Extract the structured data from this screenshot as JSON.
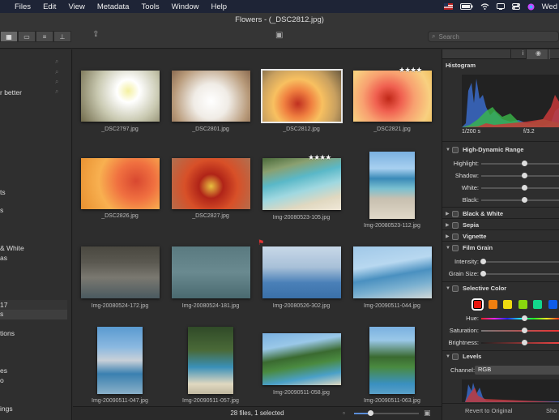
{
  "menubar": {
    "items": [
      "Files",
      "Edit",
      "View",
      "Metadata",
      "Tools",
      "Window",
      "Help"
    ],
    "clock": "Wed"
  },
  "window": {
    "title": "Flowers - (_DSC2812.jpg)",
    "search_placeholder": "Search"
  },
  "sidebar": {
    "fragments": [
      "r better",
      "ts",
      "s",
      "& White",
      "as",
      "17",
      "s",
      "tions",
      "es",
      "o",
      "ings"
    ]
  },
  "grid": {
    "items": [
      {
        "name": "_DSC2797.jpg",
        "stars": "",
        "flag": false,
        "selected": false
      },
      {
        "name": "_DSC2801.jpg",
        "stars": "",
        "flag": false,
        "selected": false
      },
      {
        "name": "_DSC2812.jpg",
        "stars": "",
        "flag": false,
        "selected": true
      },
      {
        "name": "_DSC2821.jpg",
        "stars": "★★★★",
        "flag": false,
        "selected": false
      },
      {
        "name": "_DSC2826.jpg",
        "stars": "",
        "flag": false,
        "selected": false
      },
      {
        "name": "_DSC2827.jpg",
        "stars": "",
        "flag": false,
        "selected": false
      },
      {
        "name": "Img-20080523-105.jpg",
        "stars": "★★★★",
        "flag": false,
        "selected": false
      },
      {
        "name": "Img-20080523-112.jpg",
        "stars": "",
        "flag": false,
        "selected": false
      },
      {
        "name": "Img-20080524-172.jpg",
        "stars": "",
        "flag": false,
        "selected": false
      },
      {
        "name": "Img-20080524-181.jpg",
        "stars": "",
        "flag": false,
        "selected": false
      },
      {
        "name": "Img-20080526-302.jpg",
        "stars": "",
        "flag": true,
        "selected": false
      },
      {
        "name": "Img-20090511-044.jpg",
        "stars": "",
        "flag": false,
        "selected": false
      },
      {
        "name": "Img-20090511-047.jpg",
        "stars": "",
        "flag": false,
        "selected": false
      },
      {
        "name": "Img-20090511-057.jpg",
        "stars": "",
        "flag": false,
        "selected": false
      },
      {
        "name": "Img-20090511-058.jpg",
        "stars": "",
        "flag": false,
        "selected": false
      },
      {
        "name": "Img-20090511-063.jpg",
        "stars": "",
        "flag": false,
        "selected": false
      }
    ]
  },
  "status": {
    "text": "28 files, 1 selected",
    "zoom_level": 0.25
  },
  "panel": {
    "histogram": {
      "title": "Histogram",
      "shutter": "1/200 s",
      "aperture": "f/3.2"
    },
    "hdr": {
      "title": "High-Dynamic Range",
      "sliders": [
        {
          "label": "Highlight:",
          "value": 0.55
        },
        {
          "label": "Shadow:",
          "value": 0.55
        },
        {
          "label": "White:",
          "value": 0.55
        },
        {
          "label": "Black:",
          "value": 0.55
        }
      ]
    },
    "bw": {
      "title": "Black & White"
    },
    "sepia": {
      "title": "Sepia"
    },
    "vignette": {
      "title": "Vignette"
    },
    "grain": {
      "title": "Film Grain",
      "sliders": [
        {
          "label": "Intensity:",
          "value": 0.02
        },
        {
          "label": "Grain Size:",
          "value": 0.02
        }
      ]
    },
    "selective": {
      "title": "Selective Color",
      "colors": [
        "#e8160e",
        "#ee7f10",
        "#eeda10",
        "#8ad60d",
        "#12d68c",
        "#0e5ce8",
        "#8c1ee0"
      ],
      "sliders": [
        {
          "label": "Hue:",
          "value": 0.55
        },
        {
          "label": "Saturation:",
          "value": 0.55
        },
        {
          "label": "Brightness:",
          "value": 0.55
        }
      ]
    },
    "levels": {
      "title": "Levels",
      "channel_label": "Channel:",
      "channel_value": "RGB"
    },
    "revert_label": "Revert to Original",
    "show_label": "Sho"
  }
}
